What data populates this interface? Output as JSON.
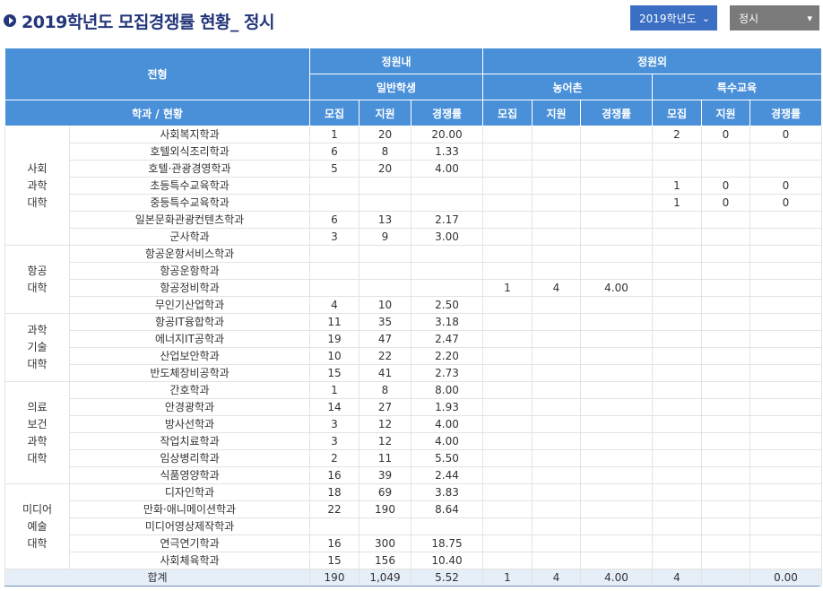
{
  "title": "2019학년도 모집경쟁률 현황_ 정시",
  "selects": {
    "year": "2019학년도",
    "type": "정시"
  },
  "headers": {
    "jeonhyeong": "전형",
    "inner": "정원내",
    "outer": "정원외",
    "general": "일반학생",
    "farm": "농어촌",
    "special": "특수교육",
    "dept": "학과 / 현황",
    "mojip": "모집",
    "jiwon": "지원",
    "rate": "경쟁률"
  },
  "colleges": [
    {
      "name": "사회\n과학\n대학",
      "depts": [
        [
          "사회복지학과",
          "1",
          "20",
          "20.00",
          "",
          "",
          "",
          "2",
          "0",
          "0"
        ],
        [
          "호텔외식조리학과",
          "6",
          "8",
          "1.33",
          "",
          "",
          "",
          "",
          "",
          ""
        ],
        [
          "호텔·관광경영학과",
          "5",
          "20",
          "4.00",
          "",
          "",
          "",
          "",
          "",
          ""
        ],
        [
          "초등특수교육학과",
          "",
          "",
          "",
          "",
          "",
          "",
          "1",
          "0",
          "0"
        ],
        [
          "중등특수교육학과",
          "",
          "",
          "",
          "",
          "",
          "",
          "1",
          "0",
          "0"
        ],
        [
          "일본문화관광컨텐츠학과",
          "6",
          "13",
          "2.17",
          "",
          "",
          "",
          "",
          "",
          ""
        ],
        [
          "군사학과",
          "3",
          "9",
          "3.00",
          "",
          "",
          "",
          "",
          "",
          ""
        ]
      ]
    },
    {
      "name": "항공\n대학",
      "depts": [
        [
          "항공운항서비스학과",
          "",
          "",
          "",
          "",
          "",
          "",
          "",
          "",
          ""
        ],
        [
          "항공운항학과",
          "",
          "",
          "",
          "",
          "",
          "",
          "",
          "",
          ""
        ],
        [
          "항공정비학과",
          "",
          "",
          "",
          "1",
          "4",
          "4.00",
          "",
          "",
          ""
        ],
        [
          "무인기산업학과",
          "4",
          "10",
          "2.50",
          "",
          "",
          "",
          "",
          "",
          ""
        ]
      ]
    },
    {
      "name": "과학\n기술\n대학",
      "depts": [
        [
          "항공IT융합학과",
          "11",
          "35",
          "3.18",
          "",
          "",
          "",
          "",
          "",
          ""
        ],
        [
          "에너지IT공학과",
          "19",
          "47",
          "2.47",
          "",
          "",
          "",
          "",
          "",
          ""
        ],
        [
          "산업보안학과",
          "10",
          "22",
          "2.20",
          "",
          "",
          "",
          "",
          "",
          ""
        ],
        [
          "반도체장비공학과",
          "15",
          "41",
          "2.73",
          "",
          "",
          "",
          "",
          "",
          ""
        ]
      ]
    },
    {
      "name": "의료\n보건\n과학\n대학",
      "depts": [
        [
          "간호학과",
          "1",
          "8",
          "8.00",
          "",
          "",
          "",
          "",
          "",
          ""
        ],
        [
          "안경광학과",
          "14",
          "27",
          "1.93",
          "",
          "",
          "",
          "",
          "",
          ""
        ],
        [
          "방사선학과",
          "3",
          "12",
          "4.00",
          "",
          "",
          "",
          "",
          "",
          ""
        ],
        [
          "작업치료학과",
          "3",
          "12",
          "4.00",
          "",
          "",
          "",
          "",
          "",
          ""
        ],
        [
          "임상병리학과",
          "2",
          "11",
          "5.50",
          "",
          "",
          "",
          "",
          "",
          ""
        ],
        [
          "식품영양학과",
          "16",
          "39",
          "2.44",
          "",
          "",
          "",
          "",
          "",
          ""
        ]
      ]
    },
    {
      "name": "미디어\n예술\n대학",
      "depts": [
        [
          "디자인학과",
          "18",
          "69",
          "3.83",
          "",
          "",
          "",
          "",
          "",
          ""
        ],
        [
          "만화·애니메이션학과",
          "22",
          "190",
          "8.64",
          "",
          "",
          "",
          "",
          "",
          ""
        ],
        [
          "미디어영상제작학과",
          "",
          "",
          "",
          "",
          "",
          "",
          "",
          "",
          ""
        ],
        [
          "연극연기학과",
          "16",
          "300",
          "18.75",
          "",
          "",
          "",
          "",
          "",
          ""
        ],
        [
          "사회체육학과",
          "15",
          "156",
          "10.40",
          "",
          "",
          "",
          "",
          "",
          ""
        ]
      ]
    }
  ],
  "total": [
    "합계",
    "190",
    "1,049",
    "5.52",
    "1",
    "4",
    "4.00",
    "4",
    "",
    "0.00"
  ]
}
